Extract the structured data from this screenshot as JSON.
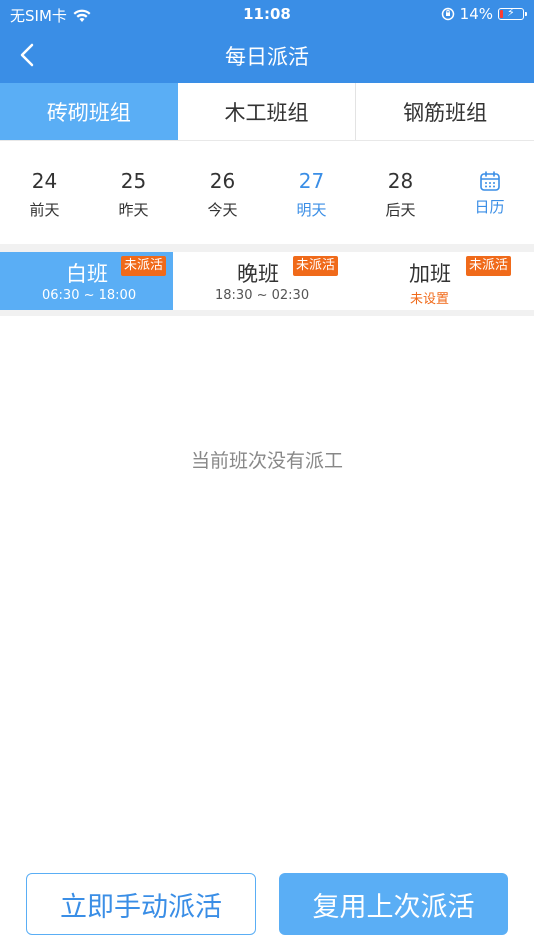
{
  "status_bar": {
    "carrier": "无SIM卡",
    "time": "11:08",
    "battery": "14%",
    "battery_level": 0.14,
    "icons": [
      "wifi-icon",
      "orientation-lock-icon",
      "battery-icon"
    ]
  },
  "nav": {
    "title": "每日派活",
    "back_icon": "chevron-left-icon"
  },
  "tabs": [
    {
      "label": "砖砌班组",
      "active": true
    },
    {
      "label": "木工班组",
      "active": false
    },
    {
      "label": "钢筋班组",
      "active": false
    }
  ],
  "dates": [
    {
      "num": "24",
      "label": "前天"
    },
    {
      "num": "25",
      "label": "昨天"
    },
    {
      "num": "26",
      "label": "今天"
    },
    {
      "num": "27",
      "label": "明天",
      "active": true
    },
    {
      "num": "28",
      "label": "后天"
    }
  ],
  "calendar": {
    "label": "日历",
    "icon": "calendar-icon"
  },
  "shifts": [
    {
      "name": "白班",
      "badge": "未派活",
      "sub": "06:30 ~ 18:00",
      "active": true
    },
    {
      "name": "晚班",
      "badge": "未派活",
      "sub": "18:30 ~ 02:30"
    },
    {
      "name": "加班",
      "badge": "未派活",
      "sub": "未设置"
    }
  ],
  "empty_message": "当前班次没有派工",
  "buttons": {
    "manual": "立即手动派活",
    "reuse": "复用上次派活"
  },
  "colors": {
    "primary": "#3a8ee6",
    "active_tab": "#5aaef5",
    "badge": "#f06a1a"
  }
}
